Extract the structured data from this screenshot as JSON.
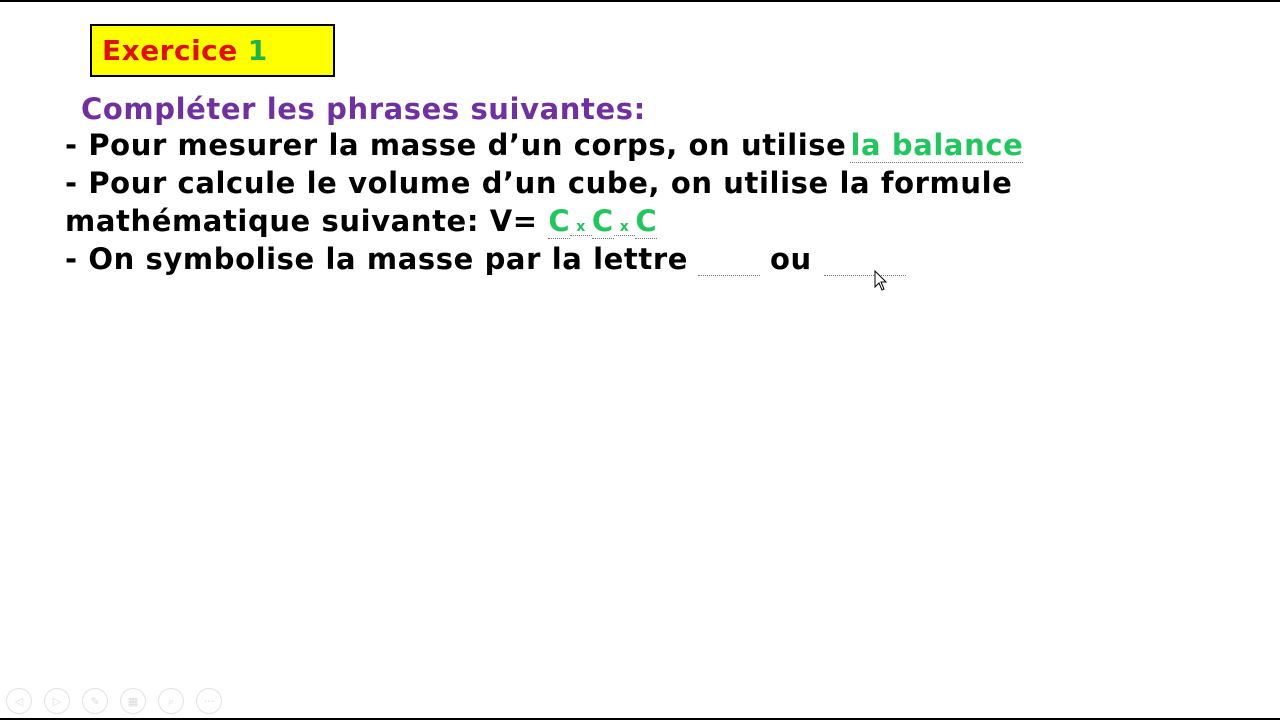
{
  "title": {
    "word": "Exercice",
    "number": "1"
  },
  "instruction": "Compléter les phrases suivantes:",
  "lines": {
    "l1_prefix": "- Pour mesurer la masse d’un corps, on utilise",
    "l1_answer": "la balance",
    "l2": "- Pour calcule le volume d’un cube, on utilise la formule",
    "l3_prefix": "mathématique suivante: V=",
    "l3_c1": "C",
    "l3_x1": "x",
    "l3_c2": "C",
    "l3_x2": "x",
    "l3_c3": "C",
    "l4_prefix": "- On symbolise la masse par la lettre",
    "l4_or": "ou"
  },
  "colors": {
    "title_bg": "#ffff00",
    "title_word": "#e01010",
    "title_number": "#22b24c",
    "instruction": "#7030a0",
    "answer": "#22c55e"
  },
  "controls": [
    {
      "icon": "previous-icon",
      "glyph": "◁"
    },
    {
      "icon": "next-icon",
      "glyph": "▷"
    },
    {
      "icon": "pen-icon",
      "glyph": "✎"
    },
    {
      "icon": "slides-grid-icon",
      "glyph": "▦"
    },
    {
      "icon": "zoom-icon",
      "glyph": "⌕"
    },
    {
      "icon": "more-options-icon",
      "glyph": "···"
    }
  ]
}
